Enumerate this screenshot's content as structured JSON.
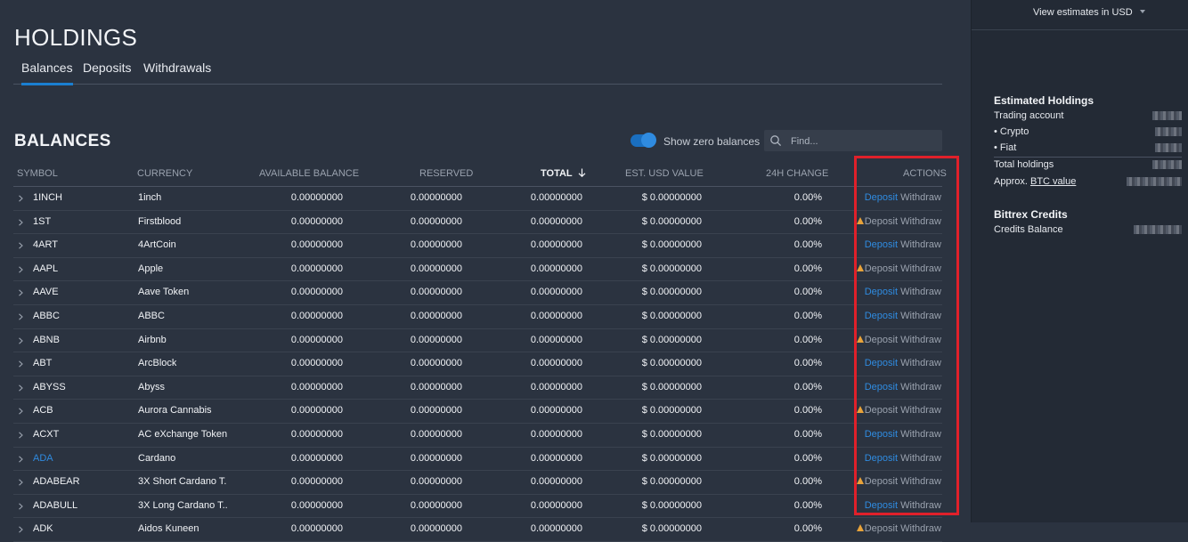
{
  "header": {
    "title": "HOLDINGS",
    "tabs": [
      {
        "label": "Balances",
        "active": true
      },
      {
        "label": "Deposits",
        "active": false
      },
      {
        "label": "Withdrawals",
        "active": false
      }
    ]
  },
  "balances": {
    "title": "BALANCES",
    "toggle_label": "Show zero balances",
    "toggle_on": true,
    "search_placeholder": "Find...",
    "columns": [
      "SYMBOL",
      "CURRENCY",
      "AVAILABLE BALANCE",
      "RESERVED",
      "TOTAL",
      "EST. USD VALUE",
      "24H CHANGE",
      "ACTIONS"
    ],
    "currency_prefix": "$",
    "deposit_label": "Deposit",
    "withdraw_label": "Withdraw",
    "rows": [
      {
        "symbol": "1INCH",
        "currency": "1inch",
        "available": "0.00000000",
        "reserved": "0.00000000",
        "total": "0.00000000",
        "usd": "0.00000000",
        "change": "0.00%",
        "warn": false,
        "link": false
      },
      {
        "symbol": "1ST",
        "currency": "Firstblood",
        "available": "0.00000000",
        "reserved": "0.00000000",
        "total": "0.00000000",
        "usd": "0.00000000",
        "change": "0.00%",
        "warn": true,
        "link": false
      },
      {
        "symbol": "4ART",
        "currency": "4ArtCoin",
        "available": "0.00000000",
        "reserved": "0.00000000",
        "total": "0.00000000",
        "usd": "0.00000000",
        "change": "0.00%",
        "warn": false,
        "link": false
      },
      {
        "symbol": "AAPL",
        "currency": "Apple",
        "available": "0.00000000",
        "reserved": "0.00000000",
        "total": "0.00000000",
        "usd": "0.00000000",
        "change": "0.00%",
        "warn": true,
        "link": false
      },
      {
        "symbol": "AAVE",
        "currency": "Aave Token",
        "available": "0.00000000",
        "reserved": "0.00000000",
        "total": "0.00000000",
        "usd": "0.00000000",
        "change": "0.00%",
        "warn": false,
        "link": false
      },
      {
        "symbol": "ABBC",
        "currency": "ABBC",
        "available": "0.00000000",
        "reserved": "0.00000000",
        "total": "0.00000000",
        "usd": "0.00000000",
        "change": "0.00%",
        "warn": false,
        "link": false
      },
      {
        "symbol": "ABNB",
        "currency": "Airbnb",
        "available": "0.00000000",
        "reserved": "0.00000000",
        "total": "0.00000000",
        "usd": "0.00000000",
        "change": "0.00%",
        "warn": true,
        "link": false
      },
      {
        "symbol": "ABT",
        "currency": "ArcBlock",
        "available": "0.00000000",
        "reserved": "0.00000000",
        "total": "0.00000000",
        "usd": "0.00000000",
        "change": "0.00%",
        "warn": false,
        "link": false
      },
      {
        "symbol": "ABYSS",
        "currency": "Abyss",
        "available": "0.00000000",
        "reserved": "0.00000000",
        "total": "0.00000000",
        "usd": "0.00000000",
        "change": "0.00%",
        "warn": false,
        "link": false
      },
      {
        "symbol": "ACB",
        "currency": "Aurora Cannabis",
        "available": "0.00000000",
        "reserved": "0.00000000",
        "total": "0.00000000",
        "usd": "0.00000000",
        "change": "0.00%",
        "warn": true,
        "link": false
      },
      {
        "symbol": "ACXT",
        "currency": "AC eXchange Token",
        "available": "0.00000000",
        "reserved": "0.00000000",
        "total": "0.00000000",
        "usd": "0.00000000",
        "change": "0.00%",
        "warn": false,
        "link": false
      },
      {
        "symbol": "ADA",
        "currency": "Cardano",
        "available": "0.00000000",
        "reserved": "0.00000000",
        "total": "0.00000000",
        "usd": "0.00000000",
        "change": "0.00%",
        "warn": false,
        "link": true
      },
      {
        "symbol": "ADABEAR",
        "currency": "3X Short Cardano T...",
        "available": "0.00000000",
        "reserved": "0.00000000",
        "total": "0.00000000",
        "usd": "0.00000000",
        "change": "0.00%",
        "warn": true,
        "link": false
      },
      {
        "symbol": "ADABULL",
        "currency": "3X Long Cardano T...",
        "available": "0.00000000",
        "reserved": "0.00000000",
        "total": "0.00000000",
        "usd": "0.00000000",
        "change": "0.00%",
        "warn": false,
        "link": false
      },
      {
        "symbol": "ADK",
        "currency": "Aidos Kuneen",
        "available": "0.00000000",
        "reserved": "0.00000000",
        "total": "0.00000000",
        "usd": "0.00000000",
        "change": "0.00%",
        "warn": true,
        "link": false
      }
    ]
  },
  "sidebar": {
    "estimates_select": "View estimates in USD",
    "estimated_holdings_title": "Estimated Holdings",
    "trading_account": "Trading account",
    "crypto": "• Crypto",
    "fiat": "• Fiat",
    "total_holdings": "Total holdings",
    "approx_prefix": "Approx.",
    "btc_value": "BTC value",
    "credits_title": "Bittrex Credits",
    "credits_balance": "Credits Balance"
  },
  "colors": {
    "background": "#2b3340",
    "sidebar": "#232a35",
    "accent": "#2f8be0",
    "warning": "#e8a33a",
    "highlight": "#e0202a"
  }
}
